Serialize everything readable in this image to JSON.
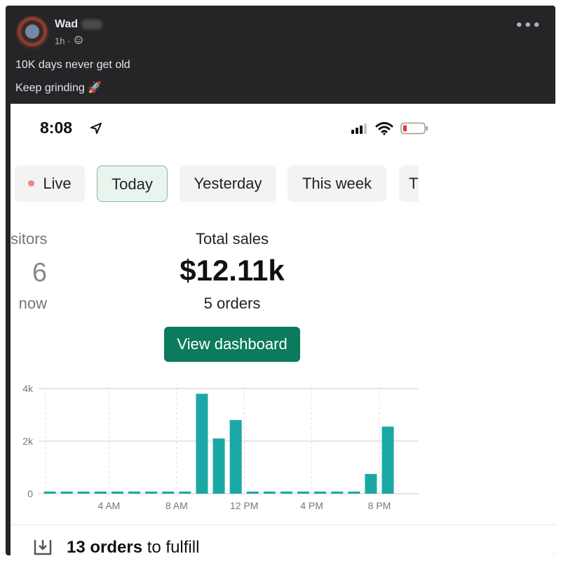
{
  "post": {
    "author": "Wad",
    "time": "1h ·",
    "privacy_icon": "friends-icon",
    "more_icon": "more-icon",
    "more_label": "•••",
    "text_line1": "10K days never get old",
    "text_line2": "Keep grinding 🚀"
  },
  "phone": {
    "status": {
      "time": "8:08",
      "icons": [
        "location-arrow-icon",
        "signal-icon",
        "wifi-icon",
        "battery-icon"
      ]
    },
    "tabs": [
      {
        "label": "Live",
        "active": false
      },
      {
        "label": "Today",
        "active": true
      },
      {
        "label": "Yesterday",
        "active": false
      },
      {
        "label": "This week",
        "active": false
      },
      {
        "label": "T",
        "active": false
      }
    ],
    "visitors": {
      "label": "sitors",
      "value": "6",
      "sub": "now"
    },
    "sales": {
      "label": "Total sales",
      "value": "$12.11k",
      "orders": "5 orders"
    },
    "dashboard_button": "View dashboard",
    "fulfill": {
      "count_text": "13 orders",
      "suffix": " to fulfill",
      "icon": "download-tray-icon"
    }
  },
  "colors": {
    "accent": "#0c7a5c",
    "bar": "#1aa8a6",
    "live_dot": "#e88a85"
  },
  "chart_data": {
    "type": "bar",
    "title": "",
    "xlabel": "",
    "ylabel": "",
    "ylim": [
      0,
      4000
    ],
    "yticks": [
      0,
      2000,
      4000
    ],
    "ytick_labels": [
      "0",
      "2k",
      "4k"
    ],
    "xtick_labels": [
      "4 AM",
      "8 AM",
      "12 PM",
      "4 PM",
      "8 PM"
    ],
    "xtick_hours": [
      4,
      8,
      12,
      16,
      20
    ],
    "categories": [
      "12 AM",
      "1 AM",
      "2 AM",
      "3 AM",
      "4 AM",
      "5 AM",
      "6 AM",
      "7 AM",
      "8 AM",
      "9 AM",
      "10 AM",
      "11 AM",
      "12 PM",
      "1 PM",
      "2 PM",
      "3 PM",
      "4 PM",
      "5 PM",
      "6 PM",
      "7 PM",
      "8 PM"
    ],
    "values": [
      0,
      0,
      0,
      0,
      0,
      0,
      0,
      0,
      0,
      3800,
      2100,
      2800,
      0,
      0,
      0,
      0,
      0,
      0,
      0,
      750,
      2550
    ],
    "grid": true
  }
}
